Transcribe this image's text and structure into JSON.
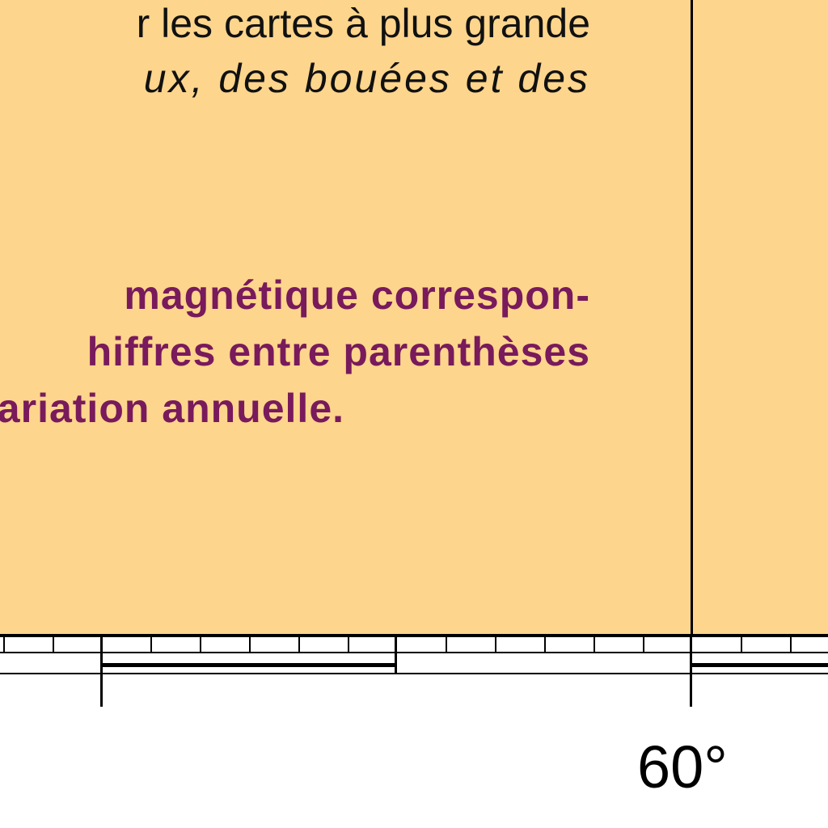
{
  "map": {
    "background_color": "#fdd58c",
    "border_color": "#000000",
    "notes": {
      "general": {
        "color": "#111111",
        "line1": "r les cartes à plus grande",
        "line2": "ux, des bouées et des"
      },
      "magnetic": {
        "color": "#781a5c",
        "line1": "magnétique correspon-",
        "line2": "hiffres entre parenthèses",
        "line3": "variation annuelle."
      }
    },
    "meridian_label": "60°"
  }
}
